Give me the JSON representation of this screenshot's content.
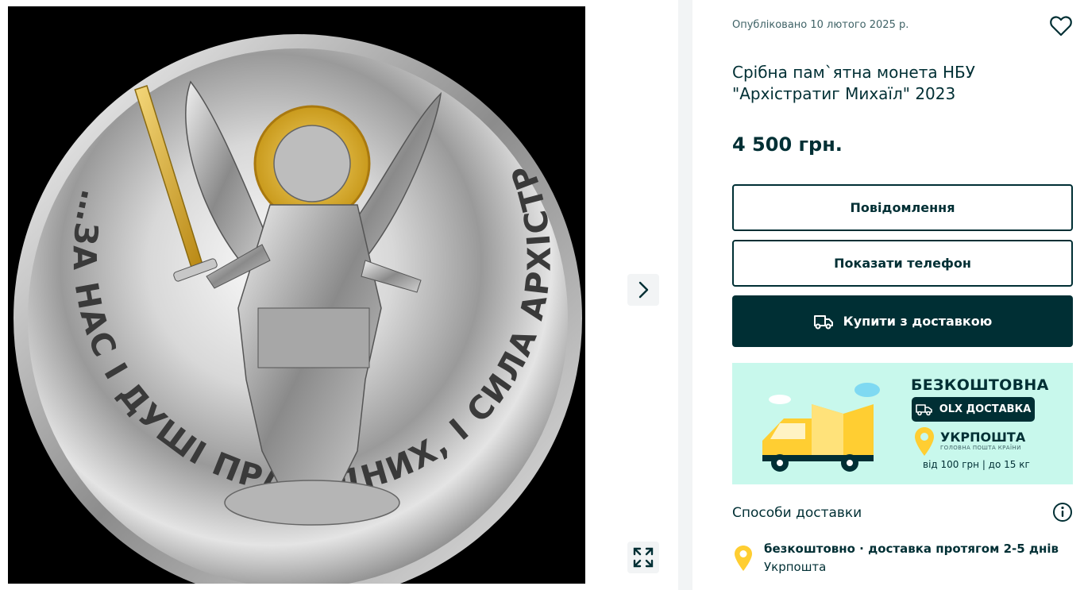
{
  "gallery": {
    "photo_alt": "",
    "coin_inscription": "…ЗА НАС І ДУШІ ПРАВЕДНИХ, І СИЛА АРХІСТРАТИГА МИХАЇЛА",
    "next_icon": "chevron-right-icon",
    "fullscreen_icon": "expand-icon"
  },
  "listing": {
    "published": "Опубліковано 10 лютого 2025 р.",
    "title_line1": "Срібна пам`ятна монета НБУ",
    "title_line2": "\"Архістратиг Михаїл\" 2023",
    "price": "4 500 грн.",
    "favorite_icon": "heart-icon"
  },
  "actions": {
    "message_label": "Повідомлення",
    "phone_label": "Показати телефон",
    "buy_label": "Купити з доставкою",
    "buy_icon": "delivery-truck-icon"
  },
  "banner": {
    "free_label": "БЕЗКОШТОВНА",
    "olx_label": "OLX ДОСТАВКА",
    "carrier": "УКРПОШТА",
    "carrier_sub": "ГОЛОВНА ПОШТА КРАЇНИ",
    "conditions": "від 100 грн | до 15 кг",
    "colors": {
      "background": "#c8f8ec",
      "truck_yellow": "#ffce32",
      "dark": "#002f34"
    }
  },
  "delivery": {
    "section_title": "Способи доставки",
    "info_icon": "info-icon",
    "method": "безкоштовно · доставка протягом 2-5 днів",
    "carrier": "Укрпошта",
    "pin_icon": "location-pin-icon"
  }
}
